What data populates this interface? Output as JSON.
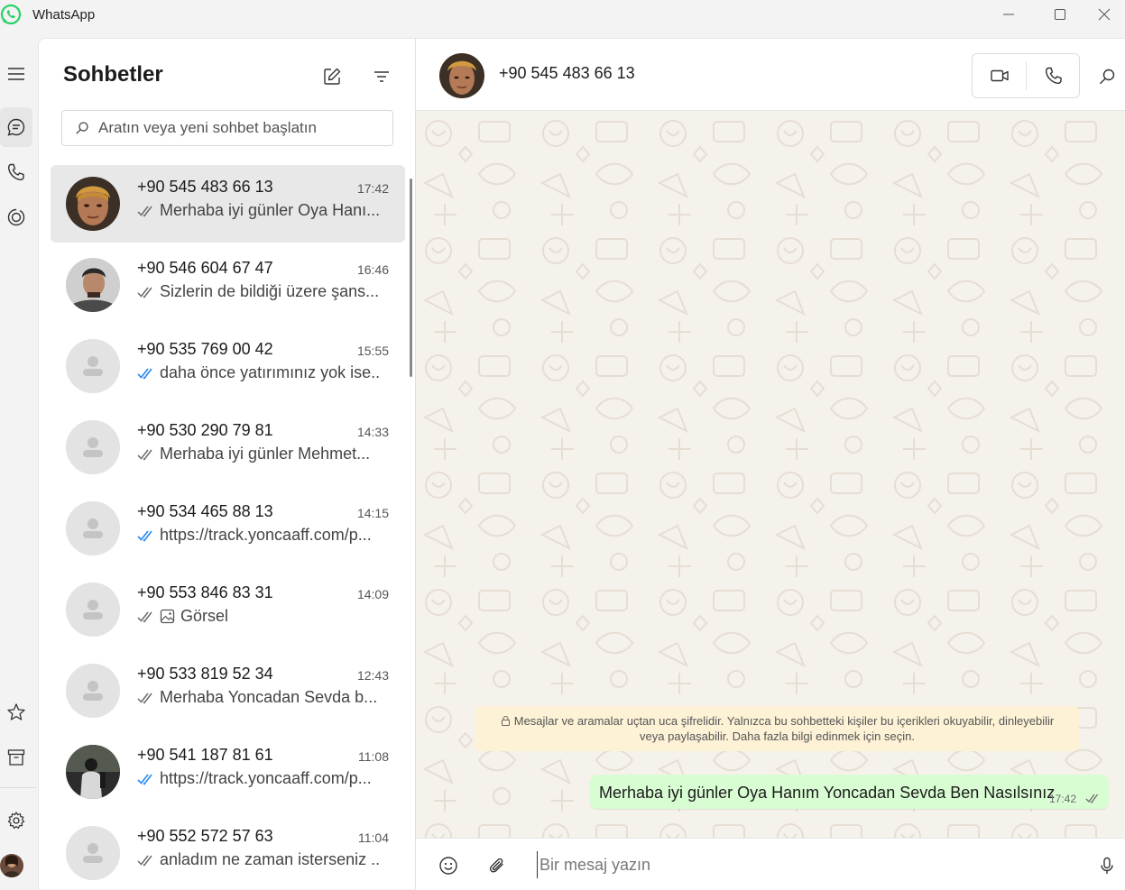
{
  "window": {
    "title": "WhatsApp"
  },
  "colors": {
    "accent": "#25d366",
    "read_tick": "#2f8bf0",
    "sent_tick": "#6b6b6b",
    "bubble": "#d9fdd3",
    "notice": "#fdf2d6",
    "wallpaper": "#f5f1eb"
  },
  "rail": {
    "items": [
      {
        "icon": "menu-icon"
      },
      {
        "icon": "chats-icon",
        "active": true
      },
      {
        "icon": "phone-icon"
      },
      {
        "icon": "status-icon"
      },
      {
        "icon": "star-icon"
      },
      {
        "icon": "archive-icon"
      },
      {
        "icon": "settings-icon"
      },
      {
        "icon": "profile-avatar"
      }
    ]
  },
  "list": {
    "title": "Sohbetler",
    "search_placeholder": "Aratın veya yeni sohbet başlatın",
    "chats": [
      {
        "name": "+90 545 483 66 13",
        "time": "17:42",
        "preview": "Merhaba iyi günler Oya Hanı...",
        "tick": "sent",
        "avatar": "photo-woman",
        "selected": true
      },
      {
        "name": "+90 546 604 67 47",
        "time": "16:46",
        "preview": "Sizlerin de bildiği üzere şans...",
        "tick": "sent",
        "avatar": "photo-man"
      },
      {
        "name": "+90 535 769 00 42",
        "time": "15:55",
        "preview": "daha önce yatırımınız yok ise...",
        "tick": "read",
        "avatar": "default"
      },
      {
        "name": "+90 530 290 79 81",
        "time": "14:33",
        "preview": "Merhaba iyi günler Mehmet...",
        "tick": "sent",
        "avatar": "default"
      },
      {
        "name": "+90 534 465 88 13",
        "time": "14:15",
        "preview": "https://track.yoncaaff.com/p...",
        "tick": "read",
        "avatar": "default"
      },
      {
        "name": "+90 553 846 83 31",
        "time": "14:09",
        "preview": "Görsel",
        "tick": "sent",
        "avatar": "default",
        "image": true
      },
      {
        "name": "+90 533 819 52 34",
        "time": "12:43",
        "preview": "Merhaba Yoncadan Sevda b...",
        "tick": "sent",
        "avatar": "default"
      },
      {
        "name": "+90 541 187 81 61",
        "time": "11:08",
        "preview": "https://track.yoncaaff.com/p...",
        "tick": "read",
        "avatar": "photo-dark"
      },
      {
        "name": "+90 552 572 57 63",
        "time": "11:04",
        "preview": "anladım ne zaman isterseniz ...",
        "tick": "sent",
        "avatar": "default"
      }
    ]
  },
  "conversation": {
    "name": "+90 545 483 66 13",
    "notice_line1": "Mesajlar ve aramalar uçtan uca şifrelidir. Yalnızca bu sohbetteki kişiler bu içerikleri okuyabilir, dinleyebilir",
    "notice_line2": "veya paylaşabilir. Daha fazla bilgi edinmek için seçin.",
    "message": {
      "text": "Merhaba iyi günler Oya Hanım Yoncadan Sevda Ben Nasılsınız",
      "time": "17:42",
      "tick": "sent"
    },
    "composer_placeholder": "Bir mesaj yazın"
  }
}
